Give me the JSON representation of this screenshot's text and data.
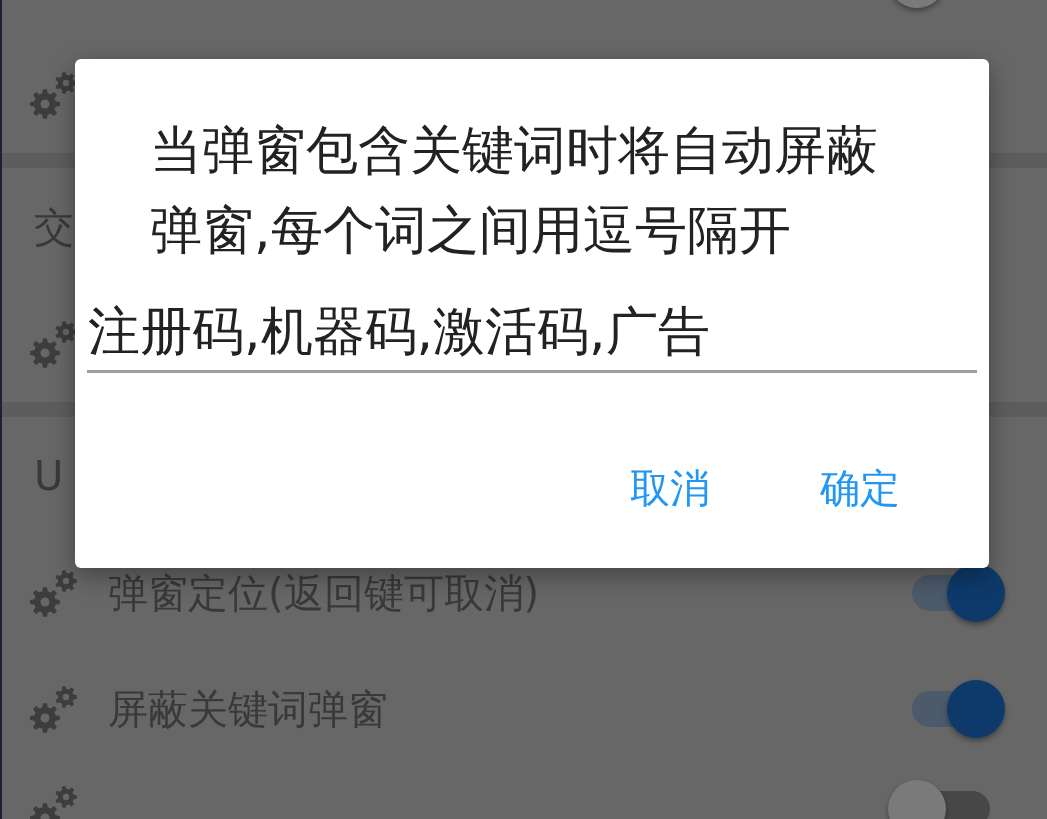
{
  "settings_list": {
    "items": [
      {
        "kind": "setting",
        "icon": false,
        "switch": {
          "on": false
        }
      },
      {
        "kind": "setting",
        "icon": true
      },
      {
        "kind": "divider"
      },
      {
        "kind": "section",
        "title": "交"
      },
      {
        "kind": "setting",
        "icon": true
      },
      {
        "kind": "divider"
      },
      {
        "kind": "section",
        "title": "U"
      },
      {
        "kind": "setting",
        "icon": true,
        "label": "弹窗定位(返回键可取消)",
        "switch": {
          "on": true
        }
      },
      {
        "kind": "setting",
        "icon": true,
        "label": "屏蔽关键词弹窗",
        "switch": {
          "on": true
        }
      },
      {
        "kind": "setting",
        "icon": true,
        "switch": {
          "on": false
        }
      }
    ]
  },
  "dialog": {
    "message": "当弹窗包含关键词时将自动屏蔽弹窗,每个词之间用逗号隔开",
    "input": {
      "value": "注册码,机器码,激活码,广告"
    },
    "buttons": [
      {
        "label": "取消"
      },
      {
        "label": "确定"
      }
    ]
  }
}
